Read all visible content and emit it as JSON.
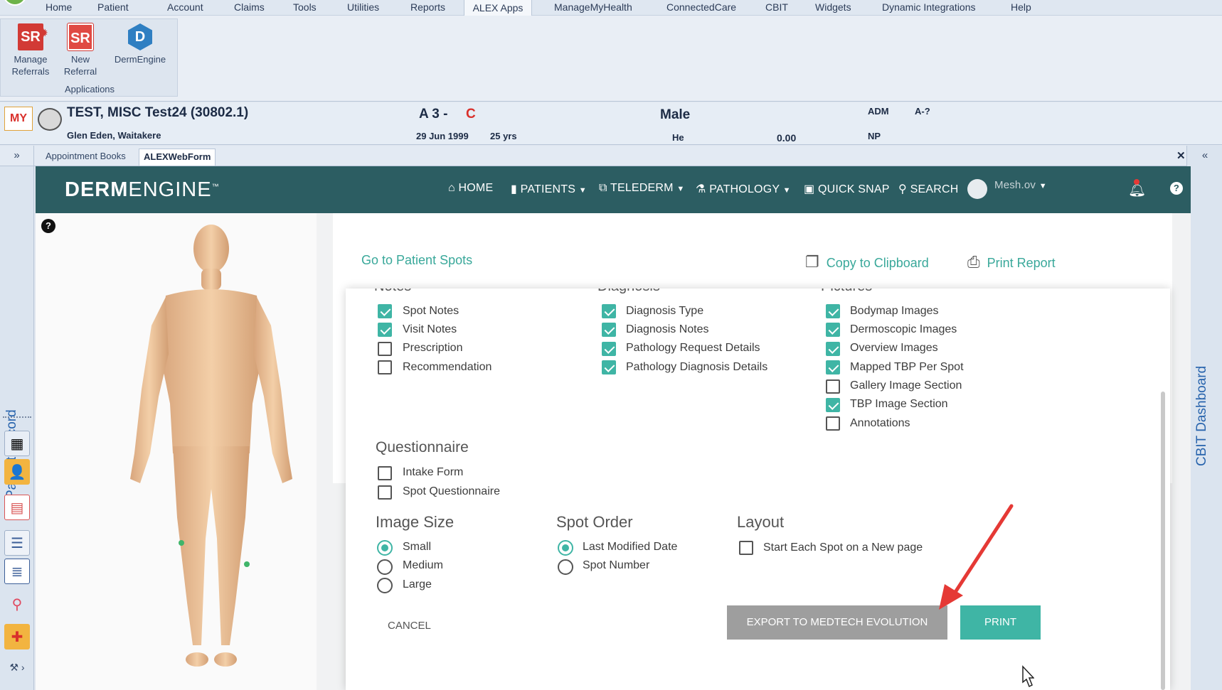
{
  "menubar": {
    "items": [
      "Home",
      "Patient",
      "Account",
      "Claims",
      "Tools",
      "Utilities",
      "Reports",
      "ALEX Apps",
      "ManageMyHealth",
      "ConnectedCare",
      "CBIT",
      "Widgets",
      "Dynamic Integrations",
      "Help"
    ],
    "active": "ALEX Apps"
  },
  "ribbon": {
    "buttons": [
      {
        "line1": "Manage",
        "line2": "Referrals",
        "icon": "sr-referrals-icon"
      },
      {
        "line1": "New",
        "line2": "Referral",
        "icon": "sr-new-referral-icon"
      },
      {
        "line1": "DermEngine",
        "line2": "",
        "icon": "dermengine-d-icon"
      }
    ],
    "group_label": "Applications"
  },
  "patient": {
    "name": "TEST, MISC Test24 (30802.1)",
    "address": "Glen Eden, Waitakere",
    "code_a": "A 3 -",
    "code_c": "C",
    "dob": "29 Jun 1999",
    "age": "25 yrs",
    "gender": "Male",
    "he": "He",
    "balance": "0.00",
    "adm": "ADM",
    "a_q": "A-?",
    "np": "NP",
    "myhealth_logo": "MY"
  },
  "doc_tabs": {
    "tabs": [
      "Appointment Books",
      "ALEXWebForm"
    ],
    "expand": "»",
    "close": "✕",
    "collapse_right": "«"
  },
  "side": {
    "left_label": "Patient Record",
    "right_label": "CBIT Dashboard"
  },
  "nav": {
    "brand_derm": "DERM",
    "brand_engine": "ENGINE",
    "brand_tm": "™",
    "home": "HOME",
    "patients": "PATIENTS",
    "telederm": "TELEDERM",
    "pathology": "PATHOLOGY",
    "quick_snap": "QUICK SNAP",
    "search": "SEARCH",
    "user": "Mesh.ov"
  },
  "panel": {
    "help": "?",
    "go_to_spots": "Go to Patient Spots",
    "copy_clipboard": "Copy to Clipboard",
    "print_report": "Print Report"
  },
  "modal": {
    "notes_title": "Notes",
    "diagnosis_title": "Diagnosis",
    "pictures_title": "Pictures",
    "notes": [
      {
        "label": "Spot Notes",
        "checked": true
      },
      {
        "label": "Visit Notes",
        "checked": true
      },
      {
        "label": "Prescription",
        "checked": false
      },
      {
        "label": "Recommendation",
        "checked": false
      }
    ],
    "diagnosis": [
      {
        "label": "Diagnosis Type",
        "checked": true
      },
      {
        "label": "Diagnosis Notes",
        "checked": true
      },
      {
        "label": "Pathology Request Details",
        "checked": true
      },
      {
        "label": "Pathology Diagnosis Details",
        "checked": true
      }
    ],
    "pictures": [
      {
        "label": "Bodymap Images",
        "checked": true
      },
      {
        "label": "Dermoscopic Images",
        "checked": true
      },
      {
        "label": "Overview Images",
        "checked": true
      },
      {
        "label": "Mapped TBP Per Spot",
        "checked": true
      },
      {
        "label": "Gallery Image Section",
        "checked": false
      },
      {
        "label": "TBP Image Section",
        "checked": true
      },
      {
        "label": "Annotations",
        "checked": false
      }
    ],
    "questionnaire_title": "Questionnaire",
    "questionnaire": [
      {
        "label": "Intake Form",
        "checked": false
      },
      {
        "label": "Spot Questionnaire",
        "checked": false
      }
    ],
    "image_size_title": "Image Size",
    "image_size": [
      {
        "label": "Small",
        "selected": true
      },
      {
        "label": "Medium",
        "selected": false
      },
      {
        "label": "Large",
        "selected": false
      }
    ],
    "spot_order_title": "Spot Order",
    "spot_order": [
      {
        "label": "Last Modified Date",
        "selected": true
      },
      {
        "label": "Spot Number",
        "selected": false
      }
    ],
    "layout_title": "Layout",
    "layout_option": {
      "label": "Start Each Spot on a New page",
      "checked": false
    },
    "cancel": "CANCEL",
    "export": "EXPORT TO MEDTECH EVOLUTION",
    "print": "PRINT"
  },
  "colors": {
    "teal": "#3fb5a5",
    "navbar": "#2c5d62",
    "annotation_arrow": "#e53935"
  }
}
